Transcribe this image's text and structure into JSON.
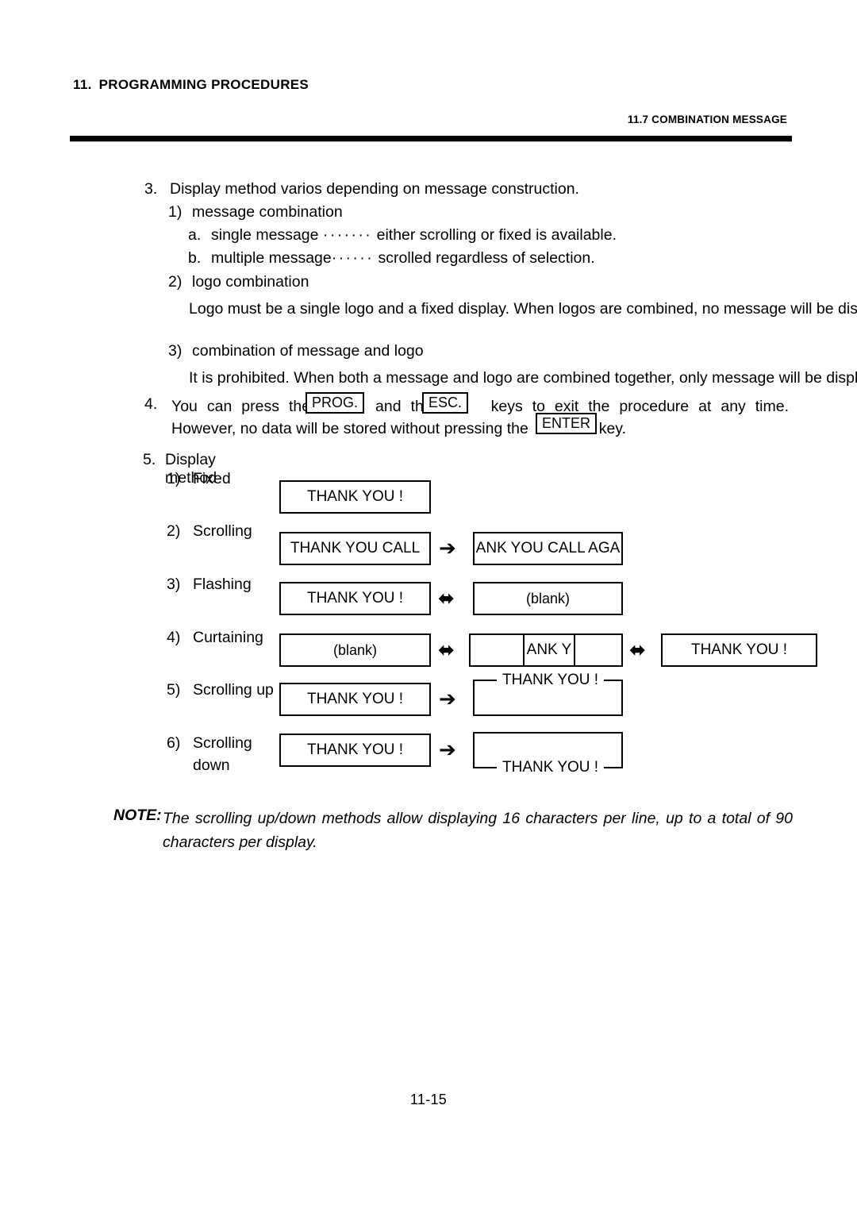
{
  "header": {
    "chapter_number": "11.",
    "chapter_title": "PROGRAMMING PROCEDURES",
    "section_title": "11.7 COMBINATION MESSAGE"
  },
  "content": {
    "item3": {
      "marker": "3.",
      "title": "Display method varios depending on message construction.",
      "sub1": {
        "marker": "1)",
        "title": "message combination"
      },
      "sub_a": {
        "marker": "a.",
        "label": "single message",
        "leader": "·······",
        "text": "either scrolling or fixed is available."
      },
      "sub_b": {
        "marker": "b.",
        "label": "multiple message",
        "leader": "······",
        "text": "scrolled regardless of selection."
      },
      "sub2": {
        "marker": "2)",
        "title": "logo combination",
        "body": "Logo must be a single logo and a fixed display.  When logos are combined, no message will be displayed."
      },
      "sub3": {
        "marker": "3)",
        "title": "combination of message and logo",
        "body": "It is prohibited.  When both a message and logo are combined together, only message will be displayed."
      }
    },
    "item4": {
      "marker": "4.",
      "line1_a": "You can press the",
      "key_prog": "PROG.",
      "line1_b": "and the",
      "key_esc": "ESC.",
      "line1_c": "keys to exit the procedure at any time.",
      "line2_a": "However, no data will be stored without pressing the",
      "key_enter": "ENTER",
      "line2_b": "key."
    },
    "item5": {
      "marker": "5.",
      "title": "Display method",
      "methods": [
        {
          "marker": "1)",
          "label": "Fixed",
          "label2": "",
          "boxes": [
            {
              "text": "THANK YOU !"
            }
          ],
          "arrows": []
        },
        {
          "marker": "2)",
          "label": "Scrolling",
          "label2": "",
          "boxes": [
            {
              "text": "THANK YOU CALL"
            },
            {
              "text": "ANK YOU CALL AGA"
            }
          ],
          "arrows": [
            "right"
          ]
        },
        {
          "marker": "3)",
          "label": "Flashing",
          "label2": "",
          "boxes": [
            {
              "text": "THANK YOU !"
            },
            {
              "text": "(blank)"
            }
          ],
          "arrows": [
            "both"
          ]
        },
        {
          "marker": "4)",
          "label": "Curtaining",
          "label2": "",
          "boxes": [
            {
              "text": "(blank)"
            },
            {
              "text": "ANK Y"
            },
            {
              "text": "THANK YOU !"
            }
          ],
          "arrows": [
            "both",
            "both"
          ]
        },
        {
          "marker": "5)",
          "label": "Scrolling up",
          "label2": "",
          "boxes": [
            {
              "text": "THANK YOU !"
            },
            {
              "text": "THANK YOU !"
            }
          ],
          "arrows": [
            "right"
          ]
        },
        {
          "marker": "6)",
          "label": "Scrolling",
          "label2": "down",
          "boxes": [
            {
              "text": "THANK YOU !"
            },
            {
              "text": "THANK YOU !"
            }
          ],
          "arrows": [
            "right"
          ]
        }
      ]
    },
    "note": {
      "label": "NOTE:",
      "text": "The scrolling up/down methods allow displaying 16 characters per line, up to a total of 90 characters per display."
    }
  },
  "footer": {
    "page_number": "11-15"
  },
  "icons": {
    "arrow_right": "➔",
    "arrow_both": "⬌"
  },
  "colors": {
    "ink": "#000000",
    "paper": "#ffffff"
  }
}
